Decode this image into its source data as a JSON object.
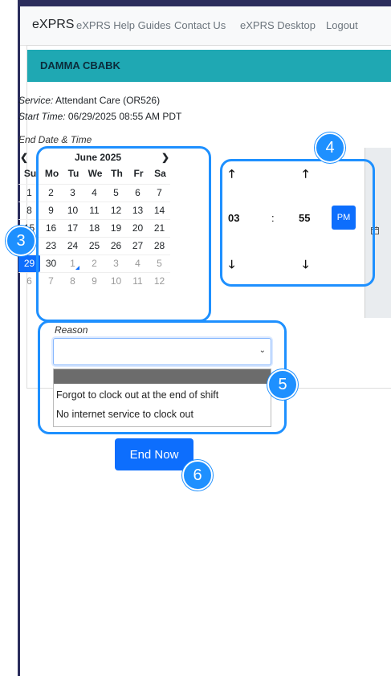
{
  "nav": {
    "brand": "eXPRS",
    "links": [
      "eXPRS Help Guides",
      "Contact Us",
      "eXPRS Desktop",
      "Logout"
    ]
  },
  "card": {
    "header": "DAMMA CBABK",
    "service_label": "Service:",
    "service_value": "Attendant Care (OR526)",
    "start_label": "Start Time:",
    "start_value": "06/29/2025 08:55 AM PDT",
    "end_label": "End Date & Time"
  },
  "calendar": {
    "prev": "❮",
    "next": "❯",
    "month_title": "June 2025",
    "weekdays": [
      "Su",
      "Mo",
      "Tu",
      "We",
      "Th",
      "Fr",
      "Sa"
    ],
    "weeks": [
      [
        "1",
        "2",
        "3",
        "4",
        "5",
        "6",
        "7"
      ],
      [
        "8",
        "9",
        "10",
        "11",
        "12",
        "13",
        "14"
      ],
      [
        "15",
        "16",
        "17",
        "18",
        "19",
        "20",
        "21"
      ],
      [
        "22",
        "23",
        "24",
        "25",
        "26",
        "27",
        "28"
      ],
      [
        "29",
        "30",
        "1",
        "2",
        "3",
        "4",
        "5"
      ],
      [
        "6",
        "7",
        "8",
        "9",
        "10",
        "11",
        "12"
      ]
    ],
    "selected_day": "29"
  },
  "time": {
    "up_arrow": "🡑",
    "down_arrow": "🡓",
    "hour": "03",
    "separator": ":",
    "minute": "55",
    "period": "PM"
  },
  "reason": {
    "label": "Reason",
    "selected": "",
    "caret": "⌄",
    "options": [
      "Forgot to clock out at the end of shift",
      "No internet service to clock out"
    ]
  },
  "actions": {
    "end_now": "End Now"
  },
  "annotations": [
    "3",
    "4",
    "5",
    "6"
  ],
  "colors": {
    "accent": "#1e90ff",
    "header": "#1fa8b3",
    "primary": "#0d6efd"
  },
  "icons": {
    "calendar": "calendar-icon"
  }
}
